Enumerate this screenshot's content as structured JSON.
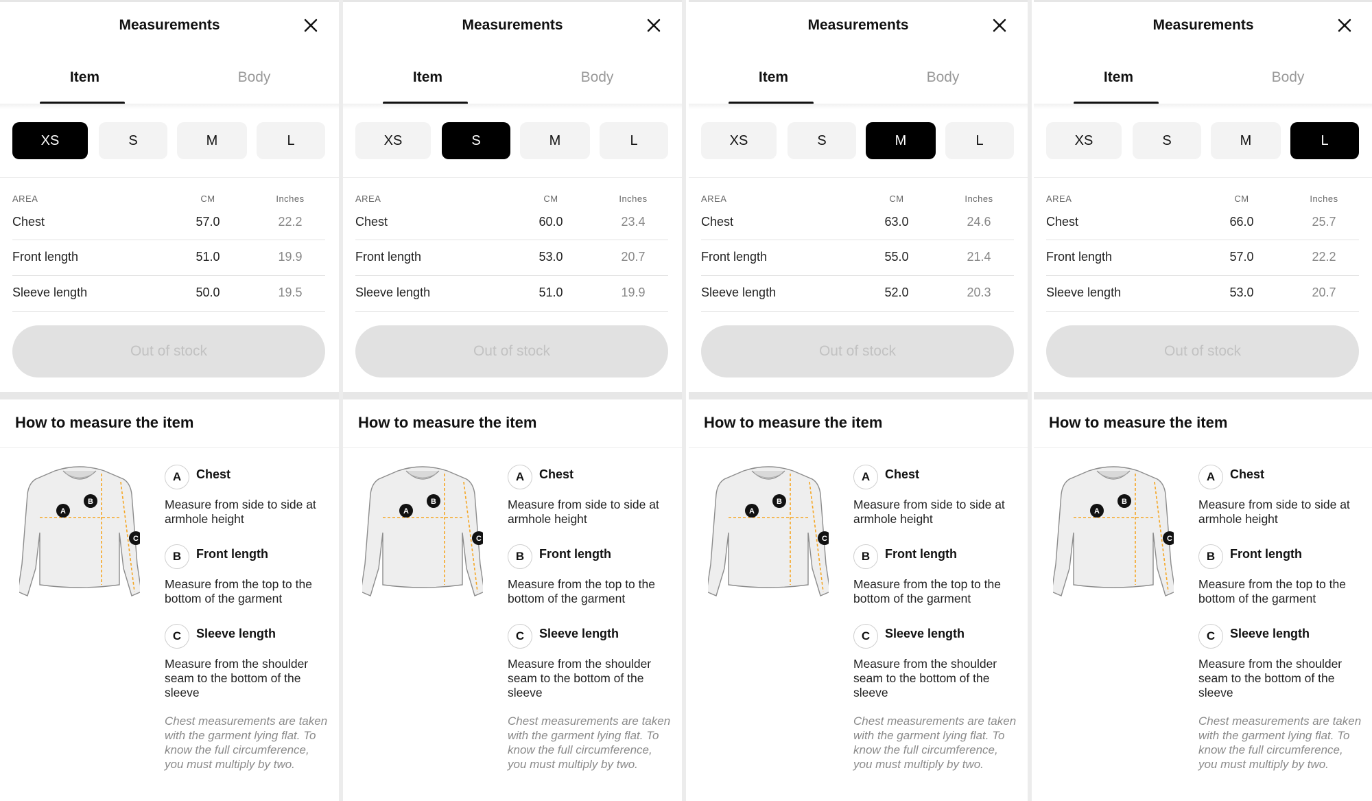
{
  "panels": [
    {
      "header": {
        "title": "Measurements",
        "close_icon": "close-icon"
      },
      "tabs": [
        {
          "label": "Item",
          "active": true
        },
        {
          "label": "Body",
          "active": false
        }
      ],
      "sizes": [
        {
          "label": "XS",
          "selected": true
        },
        {
          "label": "S",
          "selected": false
        },
        {
          "label": "M",
          "selected": false
        },
        {
          "label": "L",
          "selected": false
        }
      ],
      "table": {
        "headers": {
          "area": "AREA",
          "cm": "CM",
          "inches": "Inches"
        },
        "rows": [
          {
            "area": "Chest",
            "cm": "57.0",
            "inches": "22.2"
          },
          {
            "area": "Front length",
            "cm": "51.0",
            "inches": "19.9"
          },
          {
            "area": "Sleeve length",
            "cm": "50.0",
            "inches": "19.5"
          }
        ]
      },
      "cta": {
        "label": "Out of stock"
      },
      "howto": {
        "title": "How to measure the item",
        "measurements": [
          {
            "letter": "A",
            "name": "Chest",
            "desc": "Measure from side to side at armhole height"
          },
          {
            "letter": "B",
            "name": "Front length",
            "desc": "Measure from the top to the bottom of the garment"
          },
          {
            "letter": "C",
            "name": "Sleeve length",
            "desc": "Measure from the shoulder seam to the bottom of the sleeve"
          }
        ],
        "note": "Chest measurements are taken with the garment lying flat. To know the full circumference, you must multiply by two."
      }
    },
    {
      "header": {
        "title": "Measurements",
        "close_icon": "close-icon"
      },
      "tabs": [
        {
          "label": "Item",
          "active": true
        },
        {
          "label": "Body",
          "active": false
        }
      ],
      "sizes": [
        {
          "label": "XS",
          "selected": false
        },
        {
          "label": "S",
          "selected": true
        },
        {
          "label": "M",
          "selected": false
        },
        {
          "label": "L",
          "selected": false
        }
      ],
      "table": {
        "headers": {
          "area": "AREA",
          "cm": "CM",
          "inches": "Inches"
        },
        "rows": [
          {
            "area": "Chest",
            "cm": "60.0",
            "inches": "23.4"
          },
          {
            "area": "Front length",
            "cm": "53.0",
            "inches": "20.7"
          },
          {
            "area": "Sleeve length",
            "cm": "51.0",
            "inches": "19.9"
          }
        ]
      },
      "cta": {
        "label": "Out of stock"
      },
      "howto": {
        "title": "How to measure the item",
        "measurements": [
          {
            "letter": "A",
            "name": "Chest",
            "desc": "Measure from side to side at armhole height"
          },
          {
            "letter": "B",
            "name": "Front length",
            "desc": "Measure from the top to the bottom of the garment"
          },
          {
            "letter": "C",
            "name": "Sleeve length",
            "desc": "Measure from the shoulder seam to the bottom of the sleeve"
          }
        ],
        "note": "Chest measurements are taken with the garment lying flat. To know the full circumference, you must multiply by two."
      }
    },
    {
      "header": {
        "title": "Measurements",
        "close_icon": "close-icon"
      },
      "tabs": [
        {
          "label": "Item",
          "active": true
        },
        {
          "label": "Body",
          "active": false
        }
      ],
      "sizes": [
        {
          "label": "XS",
          "selected": false
        },
        {
          "label": "S",
          "selected": false
        },
        {
          "label": "M",
          "selected": true
        },
        {
          "label": "L",
          "selected": false
        }
      ],
      "table": {
        "headers": {
          "area": "AREA",
          "cm": "CM",
          "inches": "Inches"
        },
        "rows": [
          {
            "area": "Chest",
            "cm": "63.0",
            "inches": "24.6"
          },
          {
            "area": "Front length",
            "cm": "55.0",
            "inches": "21.4"
          },
          {
            "area": "Sleeve length",
            "cm": "52.0",
            "inches": "20.3"
          }
        ]
      },
      "cta": {
        "label": "Out of stock"
      },
      "howto": {
        "title": "How to measure the item",
        "measurements": [
          {
            "letter": "A",
            "name": "Chest",
            "desc": "Measure from side to side at armhole height"
          },
          {
            "letter": "B",
            "name": "Front length",
            "desc": "Measure from the top to the bottom of the garment"
          },
          {
            "letter": "C",
            "name": "Sleeve length",
            "desc": "Measure from the shoulder seam to the bottom of the sleeve"
          }
        ],
        "note": "Chest measurements are taken with the garment lying flat. To know the full circumference, you must multiply by two."
      }
    },
    {
      "header": {
        "title": "Measurements",
        "close_icon": "close-icon"
      },
      "tabs": [
        {
          "label": "Item",
          "active": true
        },
        {
          "label": "Body",
          "active": false
        }
      ],
      "sizes": [
        {
          "label": "XS",
          "selected": false
        },
        {
          "label": "S",
          "selected": false
        },
        {
          "label": "M",
          "selected": false
        },
        {
          "label": "L",
          "selected": true
        }
      ],
      "table": {
        "headers": {
          "area": "AREA",
          "cm": "CM",
          "inches": "Inches"
        },
        "rows": [
          {
            "area": "Chest",
            "cm": "66.0",
            "inches": "25.7"
          },
          {
            "area": "Front length",
            "cm": "57.0",
            "inches": "22.2"
          },
          {
            "area": "Sleeve length",
            "cm": "53.0",
            "inches": "20.7"
          }
        ]
      },
      "cta": {
        "label": "Out of stock"
      },
      "howto": {
        "title": "How to measure the item",
        "measurements": [
          {
            "letter": "A",
            "name": "Chest",
            "desc": "Measure from side to side at armhole height"
          },
          {
            "letter": "B",
            "name": "Front length",
            "desc": "Measure from the top to the bottom of the garment"
          },
          {
            "letter": "C",
            "name": "Sleeve length",
            "desc": "Measure from the shoulder seam to the bottom of the sleeve"
          }
        ],
        "note": "Chest measurements are taken with the garment lying flat. To know the full circumference, you must multiply by two."
      }
    }
  ],
  "colors": {
    "selected_bg": "#000000",
    "unselected_bg": "#f3f3f3",
    "measure_line": "#f5a623",
    "disabled_button": "#e1e1e1"
  }
}
